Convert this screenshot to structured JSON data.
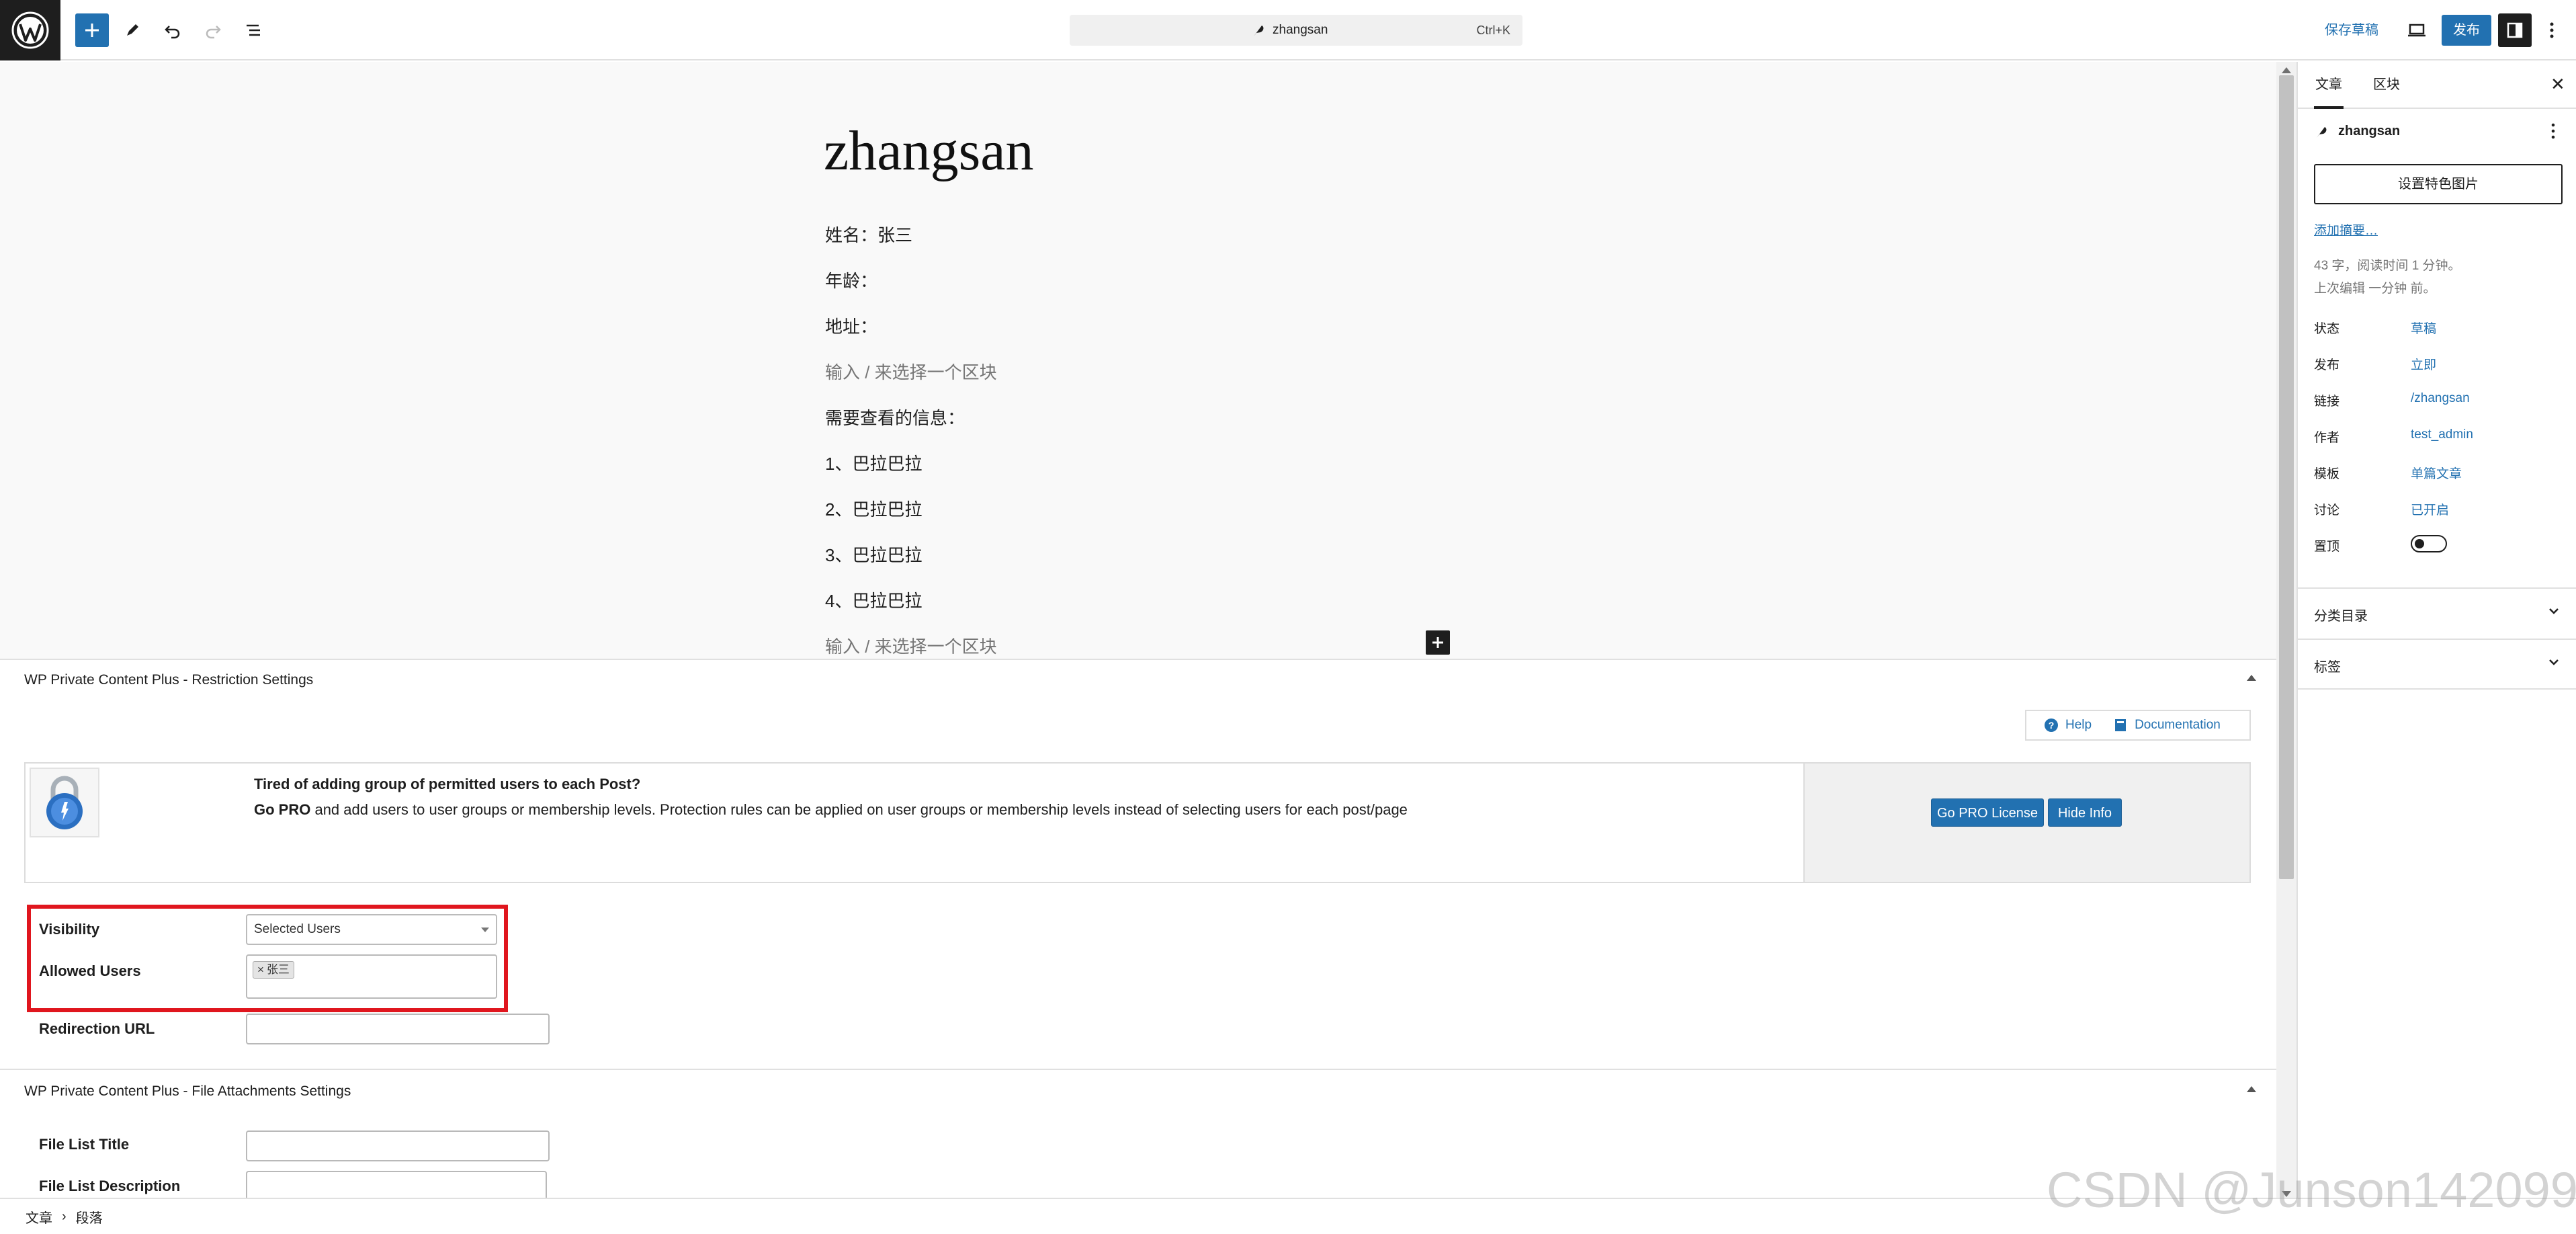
{
  "topbar": {
    "command_bar": {
      "title": "zhangsan",
      "shortcut": "Ctrl+K"
    },
    "save_draft": "保存草稿",
    "publish": "发布"
  },
  "editor": {
    "title": "zhangsan",
    "paragraphs": [
      "姓名：张三",
      "年龄：",
      "地址：",
      "输入 / 来选择一个区块",
      "需要查看的信息：",
      "1、巴拉巴拉",
      "2、巴拉巴拉",
      "3、巴拉巴拉",
      "4、巴拉巴拉",
      "输入 / 来选择一个区块"
    ]
  },
  "restriction_box": {
    "title": "WP Private Content Plus - Restriction Settings",
    "help": "Help",
    "documentation": "Documentation",
    "promo_heading": "Tired of adding group of permitted users to each Post?",
    "promo_bold": "Go PRO",
    "promo_text": " and add users to user groups or membership levels. Protection rules can be applied on user groups or membership levels instead of selecting users for each post/page",
    "go_pro_button": "Go PRO License",
    "hide_info_button": "Hide Info",
    "visibility_label": "Visibility",
    "visibility_value": "Selected Users",
    "allowed_users_label": "Allowed Users",
    "allowed_user_tag": "张三",
    "allowed_user_remove": "×",
    "redirection_label": "Redirection URL"
  },
  "attachments_box": {
    "title": "WP Private Content Plus - File Attachments Settings",
    "file_list_title_label": "File List Title",
    "file_list_description_label": "File List Description"
  },
  "sidebar": {
    "tabs": {
      "post": "文章",
      "block": "区块"
    },
    "close": "✕",
    "post_name": "zhangsan",
    "featured_image": "设置特色图片",
    "add_excerpt": "添加摘要…",
    "word_count": "43 字，阅读时间 1 分钟。",
    "last_edited": "上次编辑 一分钟 前。",
    "rows": [
      {
        "label": "状态",
        "value": "草稿"
      },
      {
        "label": "发布",
        "value": "立即"
      },
      {
        "label": "链接",
        "value": "/zhangsan"
      },
      {
        "label": "作者",
        "value": "test_admin"
      },
      {
        "label": "模板",
        "value": "单篇文章"
      },
      {
        "label": "讨论",
        "value": "已开启"
      }
    ],
    "sticky_label": "置顶",
    "panels": {
      "categories": "分类目录",
      "tags": "标签"
    }
  },
  "footer": {
    "breadcrumb_root": "文章",
    "separator": "›",
    "breadcrumb_current": "段落"
  },
  "watermark": "CSDN @Junson142099",
  "colors": {
    "accent": "#2271b1",
    "highlight_frame": "#e0161e",
    "dark": "#1e1e1e"
  }
}
